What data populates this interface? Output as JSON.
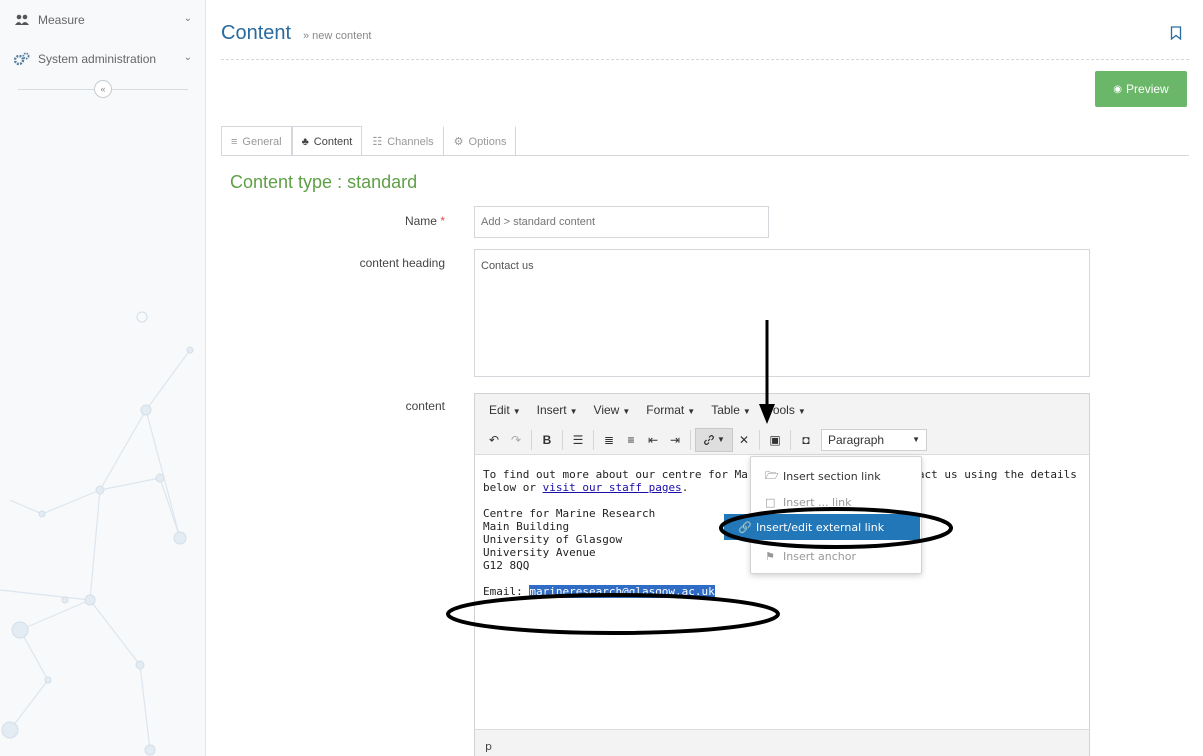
{
  "sidebar": {
    "items": [
      {
        "label": "Measure",
        "icon": "group-icon"
      },
      {
        "label": "System administration",
        "icon": "gears-icon"
      }
    ],
    "collapse_icon": "double-chevron-left-icon"
  },
  "header": {
    "title": "Content",
    "breadcrumb": "» new content",
    "preview_label": "Preview"
  },
  "tabs": [
    {
      "label": "General",
      "icon": "sliders-icon",
      "active": false
    },
    {
      "label": "Content",
      "icon": "network-icon",
      "active": true
    },
    {
      "label": "Channels",
      "icon": "sitemap-icon",
      "active": false
    },
    {
      "label": "Options",
      "icon": "gears-icon",
      "active": false
    }
  ],
  "content_type": "Content type : standard",
  "form": {
    "name_label": "Name",
    "name_required_mark": "*",
    "name_placeholder": "Add > standard content",
    "heading_label": "content heading",
    "heading_value": "Contact us",
    "content_label": "content"
  },
  "editor": {
    "menus": [
      "Edit",
      "Insert",
      "View",
      "Format",
      "Table",
      "Tools"
    ],
    "block_format": "Paragraph",
    "body": {
      "line1_prefix": "To find out more about our centre for Ma",
      "line1_suffix": "act us using the details",
      "line2_prefix": "below or ",
      "line2_link": "visit our staff pages",
      "line2_suffix": ".",
      "address": [
        "Centre for Marine Research",
        "Main Building",
        "University of Glasgow",
        "University Avenue",
        "G12 8QQ"
      ],
      "email_label": "Email: ",
      "email_value": "marineresearch@glasgow.ac.uk"
    },
    "status_path": "p",
    "link_dropdown": {
      "items": [
        {
          "label": "Insert section link",
          "icon": "folder-icon"
        },
        {
          "label": "Insert ... link",
          "icon": "file-icon"
        },
        {
          "label": "Insert/edit external link",
          "icon": "link-icon",
          "active": true
        },
        {
          "label": "Insert anchor",
          "icon": "bookmark-icon"
        }
      ]
    }
  },
  "colors": {
    "title_blue": "#2a6a9e",
    "content_type_green": "#5f9f47",
    "preview_green": "#6ab76a",
    "selection_blue": "#2f6cc6",
    "active_menu_blue": "#2277b9"
  }
}
